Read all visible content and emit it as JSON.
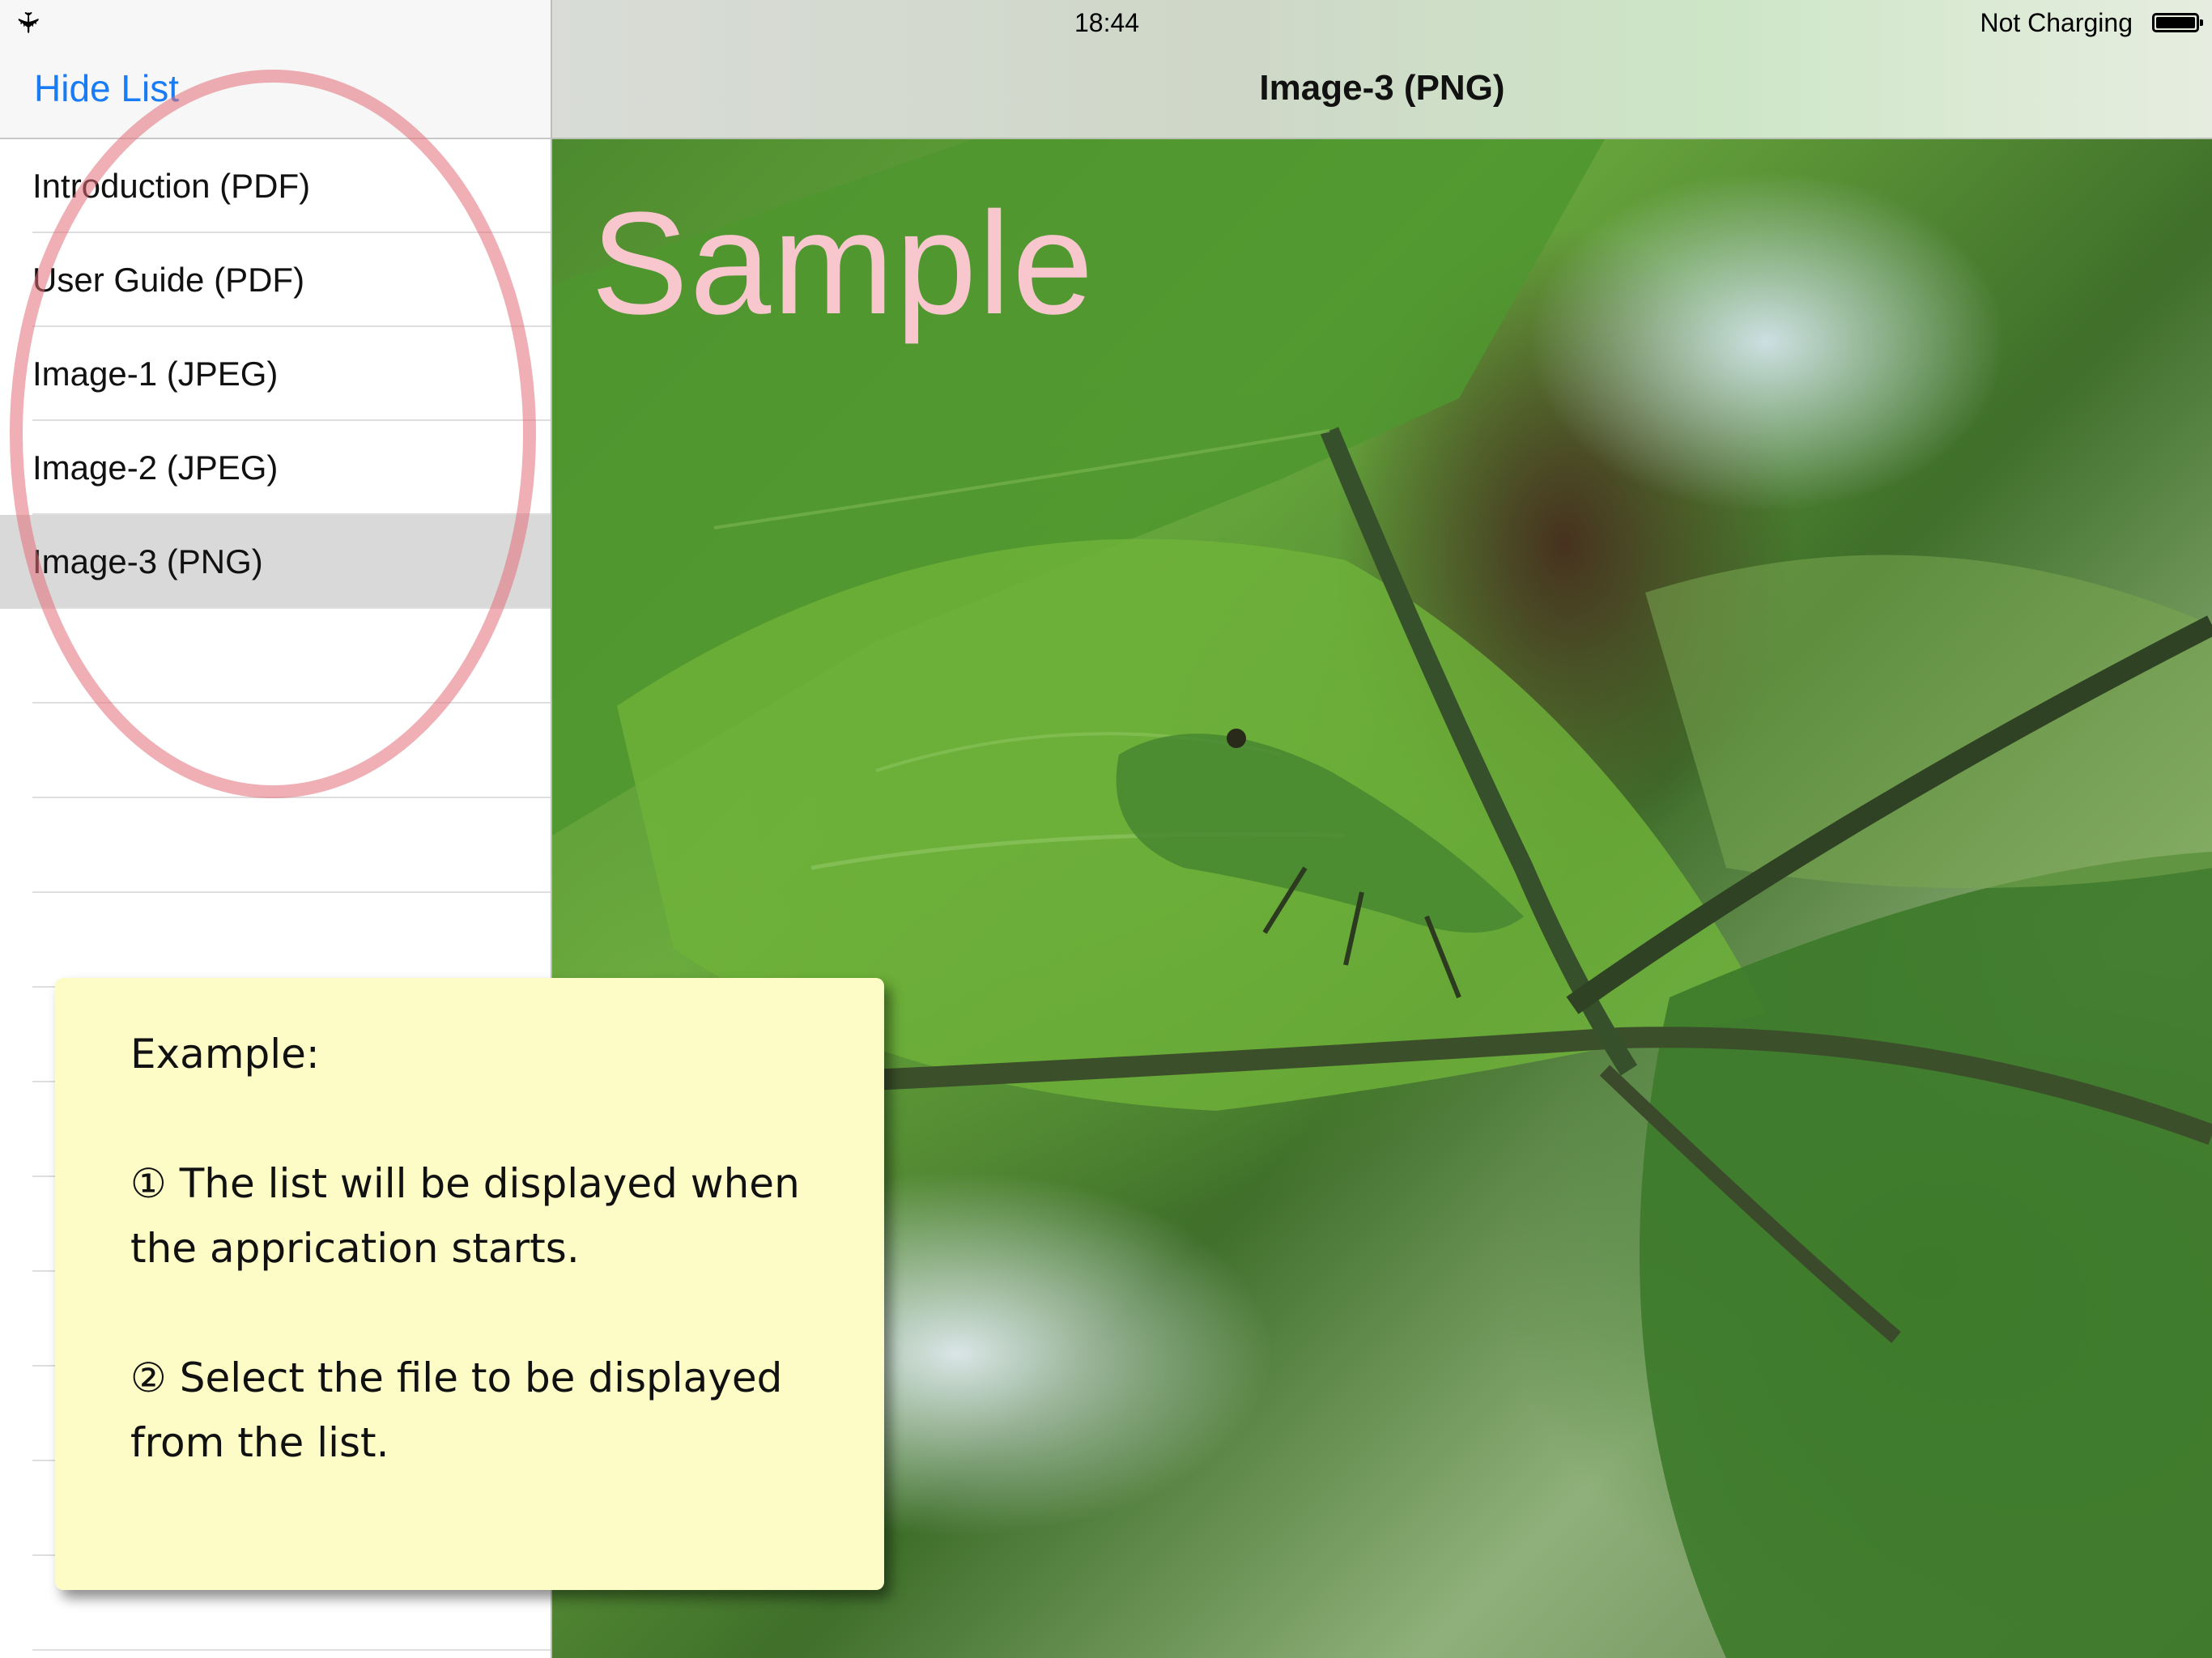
{
  "status_bar": {
    "airplane_icon": "airplane-icon",
    "time": "18:44",
    "charging": "Not Charging",
    "battery_icon": "battery-full-icon"
  },
  "sidebar": {
    "hide_list_label": "Hide List",
    "items": [
      {
        "label": "Introduction (PDF)",
        "selected": false
      },
      {
        "label": "User Guide (PDF)",
        "selected": false
      },
      {
        "label": "Image-1 (JPEG)",
        "selected": false
      },
      {
        "label": "Image-2 (JPEG)",
        "selected": false
      },
      {
        "label": "Image-3 (PNG)",
        "selected": true
      }
    ]
  },
  "detail": {
    "title": "Image-3 (PNG)",
    "image_overlay_text": "Sample"
  },
  "note": {
    "heading": "Example:",
    "step1_line1": "① The list will be displayed when",
    "step1_line2": "the apprication starts.",
    "step2_line1": "② Select the file to be displayed",
    "step2_line2": "from the list."
  },
  "colors": {
    "link_blue": "#1a7cf5",
    "selected_row": "#d9d9d9",
    "highlight_ellipse": "#e26e76",
    "note_background": "#fdfcc7",
    "sample_text": "#f7c7cd"
  }
}
